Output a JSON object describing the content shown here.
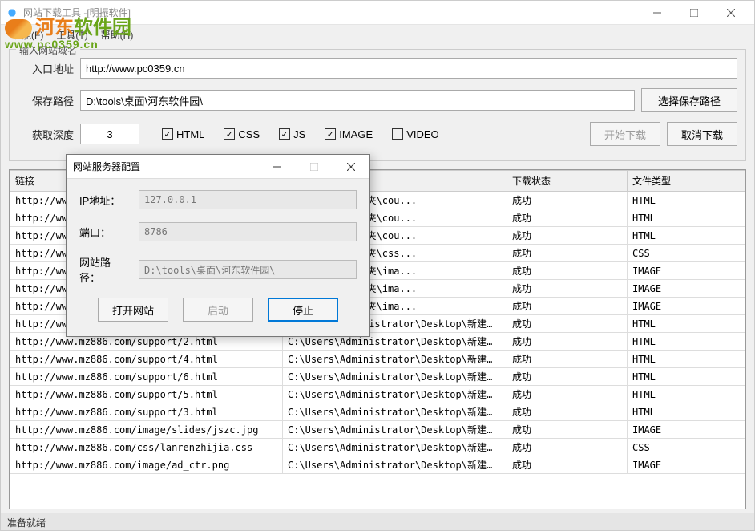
{
  "window": {
    "title": "网站下载工具 -[明振软件]"
  },
  "menu": {
    "func": "功能(F)",
    "tool": "工具(T)",
    "help": "帮助(H)"
  },
  "watermark": {
    "text": "河东软件园",
    "sub": "www.pc0359.cn"
  },
  "config": {
    "legend": "输入网站域名",
    "entry_label": "入口地址",
    "entry_value": "http://www.pc0359.cn",
    "save_label": "保存路径",
    "save_value": "D:\\tools\\桌面\\河东软件园\\",
    "choose_path_btn": "选择保存路径",
    "depth_label": "获取深度",
    "depth_value": "3",
    "cb_html": "HTML",
    "cb_css": "CSS",
    "cb_js": "JS",
    "cb_image": "IMAGE",
    "cb_video": "VIDEO",
    "start_btn": "开始下载",
    "cancel_btn": "取消下载"
  },
  "table": {
    "headers": {
      "link": "链接",
      "path": "",
      "status": "下载状态",
      "type": "文件类型"
    },
    "rows": [
      {
        "link": "http://www.m",
        "path": "esktop\\新建文件夹\\cou...",
        "status": "成功",
        "type": "HTML"
      },
      {
        "link": "http://www.m",
        "path": "esktop\\新建文件夹\\cou...",
        "status": "成功",
        "type": "HTML"
      },
      {
        "link": "http://www.m",
        "path": "esktop\\新建文件夹\\cou...",
        "status": "成功",
        "type": "HTML"
      },
      {
        "link": "http://www.m",
        "path": "esktop\\新建文件夹\\css...",
        "status": "成功",
        "type": "CSS"
      },
      {
        "link": "http://www.m",
        "path": "esktop\\新建文件夹\\ima...",
        "status": "成功",
        "type": "IMAGE"
      },
      {
        "link": "http://www.m",
        "path": "esktop\\新建文件夹\\ima...",
        "status": "成功",
        "type": "IMAGE"
      },
      {
        "link": "http://www.m",
        "path": "esktop\\新建文件夹\\ima...",
        "status": "成功",
        "type": "IMAGE"
      },
      {
        "link": "http://www.mz886.com/support/1.html",
        "path": "C:\\Users\\Administrator\\Desktop\\新建文件夹\\sup...",
        "status": "成功",
        "type": "HTML"
      },
      {
        "link": "http://www.mz886.com/support/2.html",
        "path": "C:\\Users\\Administrator\\Desktop\\新建文件夹\\sup...",
        "status": "成功",
        "type": "HTML"
      },
      {
        "link": "http://www.mz886.com/support/4.html",
        "path": "C:\\Users\\Administrator\\Desktop\\新建文件夹\\sup...",
        "status": "成功",
        "type": "HTML"
      },
      {
        "link": "http://www.mz886.com/support/6.html",
        "path": "C:\\Users\\Administrator\\Desktop\\新建文件夹\\sup...",
        "status": "成功",
        "type": "HTML"
      },
      {
        "link": "http://www.mz886.com/support/5.html",
        "path": "C:\\Users\\Administrator\\Desktop\\新建文件夹\\sup...",
        "status": "成功",
        "type": "HTML"
      },
      {
        "link": "http://www.mz886.com/support/3.html",
        "path": "C:\\Users\\Administrator\\Desktop\\新建文件夹\\sup...",
        "status": "成功",
        "type": "HTML"
      },
      {
        "link": "http://www.mz886.com/image/slides/jszc.jpg",
        "path": "C:\\Users\\Administrator\\Desktop\\新建文件夹\\ima...",
        "status": "成功",
        "type": "IMAGE"
      },
      {
        "link": "http://www.mz886.com/css/lanrenzhijia.css",
        "path": "C:\\Users\\Administrator\\Desktop\\新建文件夹\\css...",
        "status": "成功",
        "type": "CSS"
      },
      {
        "link": "http://www.mz886.com/image/ad_ctr.png",
        "path": "C:\\Users\\Administrator\\Desktop\\新建文件夹\\ima...",
        "status": "成功",
        "type": "IMAGE"
      }
    ]
  },
  "status": "准备就绪",
  "modal": {
    "title": "网站服务器配置",
    "ip_label": "IP地址：",
    "ip_value": "127.0.0.1",
    "port_label": "端口：",
    "port_value": "8786",
    "path_label": "网站路径：",
    "path_value": "D:\\tools\\桌面\\河东软件园\\",
    "open_btn": "打开网站",
    "start_btn": "启动",
    "stop_btn": "停止"
  }
}
